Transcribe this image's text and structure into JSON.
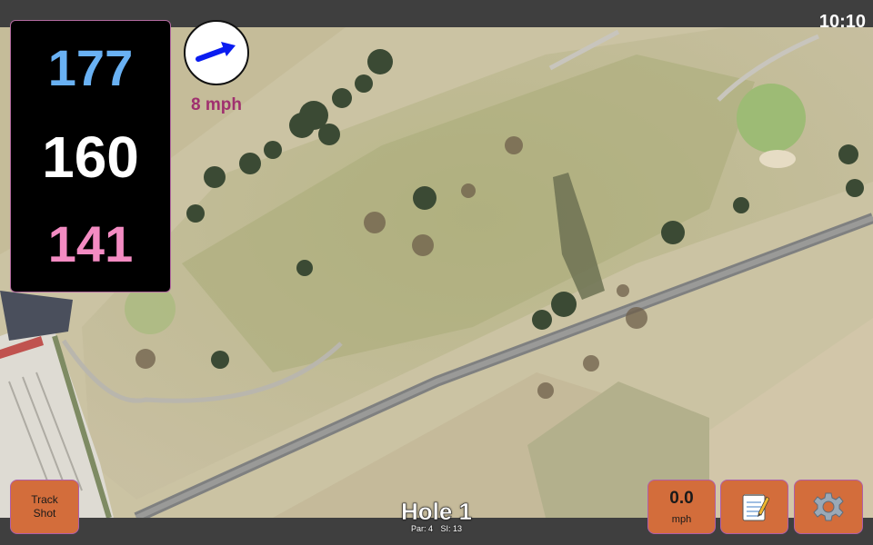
{
  "status": {
    "time": "10:10"
  },
  "distances": {
    "back": "177",
    "middle": "160",
    "front": "141"
  },
  "wind": {
    "speed": "8 mph",
    "icon": "wind-arrow-icon"
  },
  "buttons": {
    "track_shot": "Track\nShot",
    "notes_icon": "notepad-icon",
    "settings_icon": "gear-icon"
  },
  "speed": {
    "value": "0.0",
    "unit": "mph"
  },
  "hole": {
    "title": "Hole 1",
    "par": "Par: 4",
    "si": "SI: 13"
  },
  "colors": {
    "back": "#69b1f3",
    "middle": "#ffffff",
    "front": "#f38bc2",
    "wind_speed": "#a0306f",
    "button": "#d36d3b"
  }
}
